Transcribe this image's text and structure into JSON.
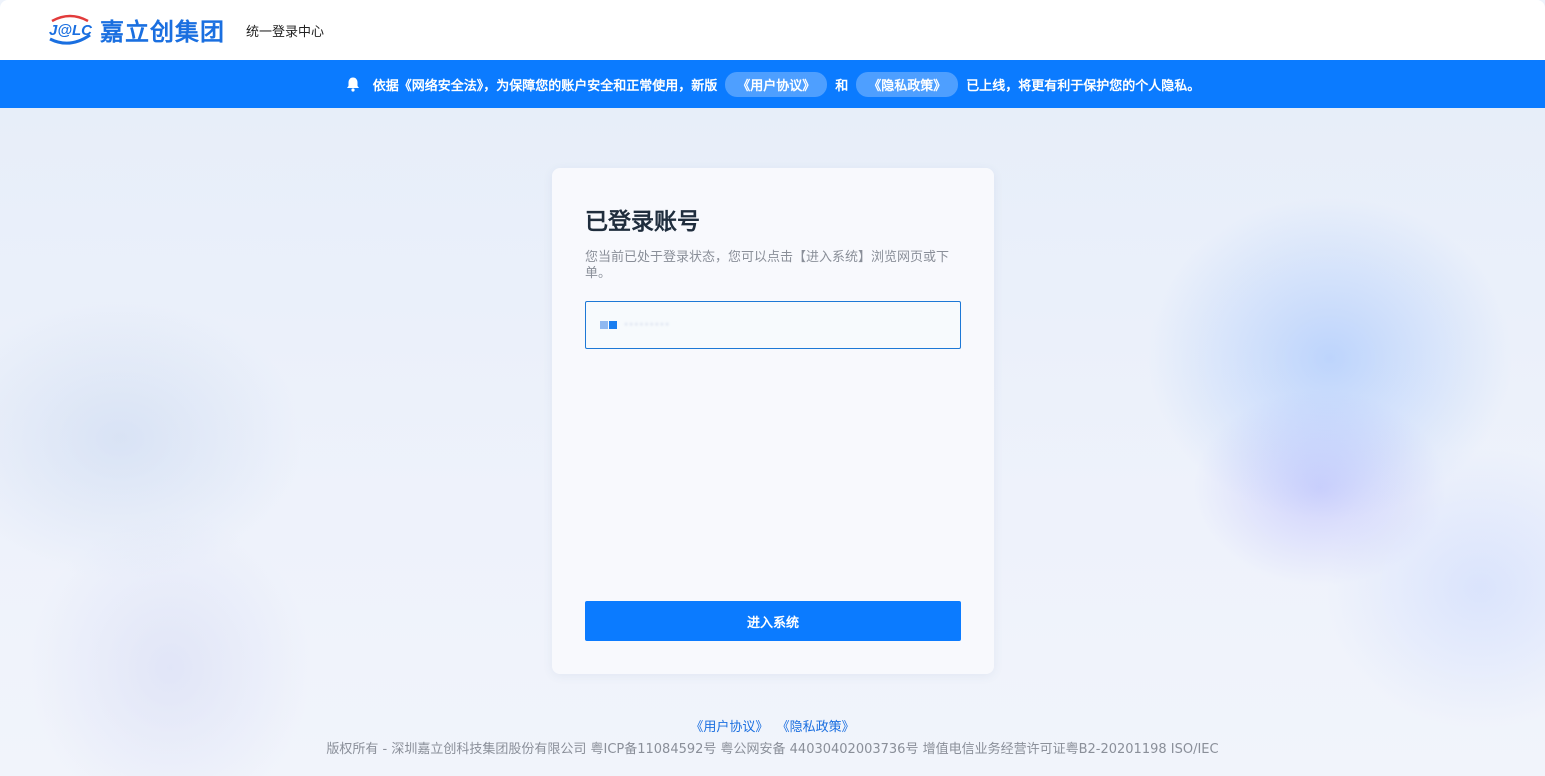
{
  "header": {
    "logo_mark": "J@LC",
    "logo_name": "嘉立创集团",
    "system_title": "统一登录中心"
  },
  "notice": {
    "icon": "bell-icon",
    "text_before": "依据《网络安全法》，为保障您的账户安全和正常使用，新版",
    "link_user_agreement": "《用户协议》",
    "text_and": "和",
    "link_privacy_policy": "《隐私政策》",
    "text_after": "已上线，将更有利于保护您的个人隐私。"
  },
  "card": {
    "title": "已登录账号",
    "description": "您当前已处于登录状态，您可以点击【进入系统】浏览网页或下单。",
    "account_display": "·········",
    "enter_button": "进入系统"
  },
  "footer": {
    "link_user_agreement": "《用户协议》",
    "link_privacy_policy": "《隐私政策》",
    "copyright": "版权所有 - 深圳嘉立创科技集团股份有限公司 粤ICP备11084592号 粤公网安备 44030402003736号 增值电信业务经营许可证粤B2-20201198  ISO/IEC"
  },
  "colors": {
    "brand_blue": "#0b7bff",
    "logo_blue": "#1a6fe0",
    "logo_red": "#e23b3b"
  }
}
